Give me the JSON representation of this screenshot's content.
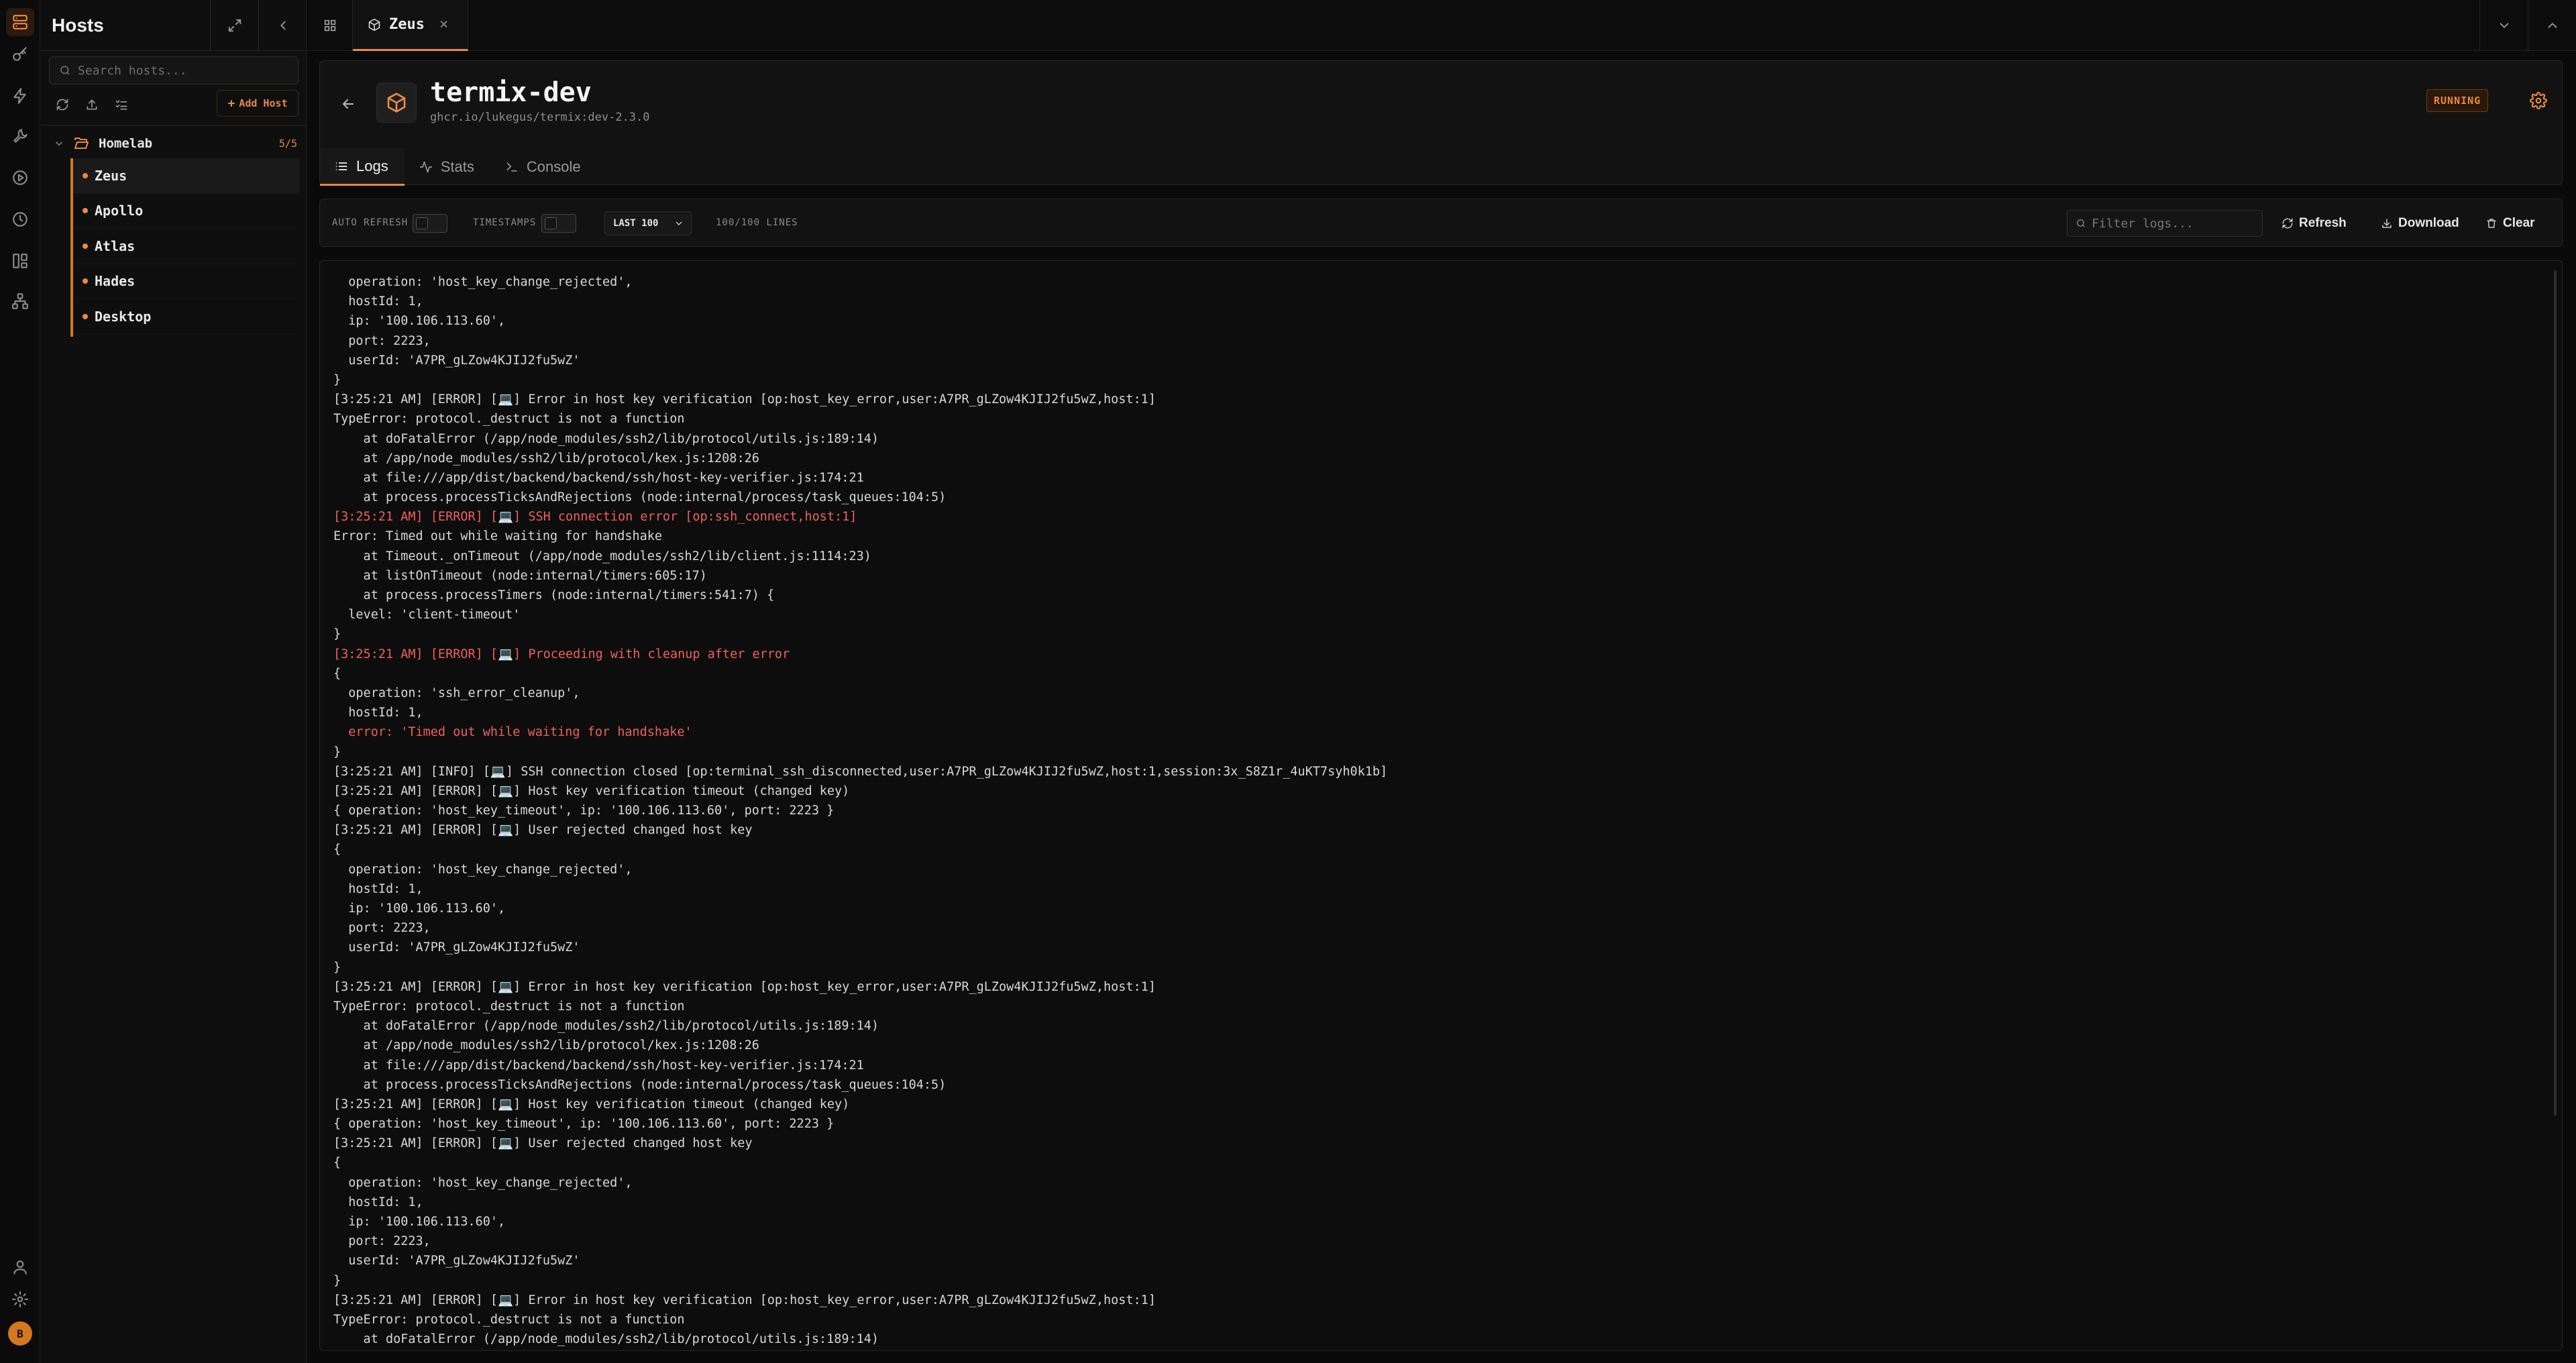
{
  "sidebar": {
    "title": "Hosts",
    "search_placeholder": "Search hosts...",
    "add_host_label": "Add Host",
    "folder": {
      "name": "Homelab",
      "count": "5/5"
    },
    "hosts": [
      "Zeus",
      "Apollo",
      "Atlas",
      "Hades",
      "Desktop"
    ],
    "user_initial": "B"
  },
  "tabbar": {
    "active_tab": "Zeus"
  },
  "container": {
    "name": "termix-dev",
    "image": "ghcr.io/lukegus/termix:dev-2.3.0",
    "status": "RUNNING",
    "tabs": [
      "Logs",
      "Stats",
      "Console"
    ]
  },
  "toolbar": {
    "auto_refresh_label": "AUTO REFRESH",
    "auto_refresh_on": false,
    "timestamps_label": "TIMESTAMPS",
    "timestamps_on": false,
    "range_selected": "LAST 100",
    "lines_count": "100/100 LINES",
    "filter_placeholder": "Filter logs...",
    "refresh_label": "Refresh",
    "download_label": "Download",
    "clear_label": "Clear"
  },
  "colors": {
    "accent": "#e98a42",
    "error": "#f0605f",
    "background": "#0a0a0a"
  },
  "logs": [
    {
      "t": "  operation: 'host_key_change_rejected',",
      "c": "n"
    },
    {
      "t": "  hostId: 1,",
      "c": "n"
    },
    {
      "t": "  ip: '100.106.113.60',",
      "c": "n"
    },
    {
      "t": "  port: 2223,",
      "c": "n"
    },
    {
      "t": "  userId: 'A7PR_gLZow4KJIJ2fu5wZ'",
      "c": "n"
    },
    {
      "t": "}",
      "c": "n"
    },
    {
      "t": "[3:25:21 AM] [ERROR] [💻] Error in host key verification [op:host_key_error,user:A7PR_gLZow4KJIJ2fu5wZ,host:1]",
      "c": "n"
    },
    {
      "t": "TypeError: protocol._destruct is not a function",
      "c": "n"
    },
    {
      "t": "    at doFatalError (/app/node_modules/ssh2/lib/protocol/utils.js:189:14)",
      "c": "n"
    },
    {
      "t": "    at /app/node_modules/ssh2/lib/protocol/kex.js:1208:26",
      "c": "n"
    },
    {
      "t": "    at file:///app/dist/backend/backend/ssh/host-key-verifier.js:174:21",
      "c": "n"
    },
    {
      "t": "    at process.processTicksAndRejections (node:internal/process/task_queues:104:5)",
      "c": "n"
    },
    {
      "t": "[3:25:21 AM] [ERROR] [💻] SSH connection error [op:ssh_connect,host:1]",
      "c": "e"
    },
    {
      "t": "Error: Timed out while waiting for handshake",
      "c": "n"
    },
    {
      "t": "    at Timeout._onTimeout (/app/node_modules/ssh2/lib/client.js:1114:23)",
      "c": "n"
    },
    {
      "t": "    at listOnTimeout (node:internal/timers:605:17)",
      "c": "n"
    },
    {
      "t": "    at process.processTimers (node:internal/timers:541:7) {",
      "c": "n"
    },
    {
      "t": "  level: 'client-timeout'",
      "c": "n"
    },
    {
      "t": "}",
      "c": "n"
    },
    {
      "t": "[3:25:21 AM] [ERROR] [💻] Proceeding with cleanup after error",
      "c": "e"
    },
    {
      "t": "{",
      "c": "n"
    },
    {
      "t": "  operation: 'ssh_error_cleanup',",
      "c": "n"
    },
    {
      "t": "  hostId: 1,",
      "c": "n"
    },
    {
      "t": "  error: 'Timed out while waiting for handshake'",
      "c": "e"
    },
    {
      "t": "}",
      "c": "n"
    },
    {
      "t": "[3:25:21 AM] [INFO] [💻] SSH connection closed [op:terminal_ssh_disconnected,user:A7PR_gLZow4KJIJ2fu5wZ,host:1,session:3x_S8Z1r_4uKT7syh0k1b]",
      "c": "n"
    },
    {
      "t": "[3:25:21 AM] [ERROR] [💻] Host key verification timeout (changed key)",
      "c": "n"
    },
    {
      "t": "{ operation: 'host_key_timeout', ip: '100.106.113.60', port: 2223 }",
      "c": "n"
    },
    {
      "t": "[3:25:21 AM] [ERROR] [💻] User rejected changed host key",
      "c": "n"
    },
    {
      "t": "{",
      "c": "n"
    },
    {
      "t": "  operation: 'host_key_change_rejected',",
      "c": "n"
    },
    {
      "t": "  hostId: 1,",
      "c": "n"
    },
    {
      "t": "  ip: '100.106.113.60',",
      "c": "n"
    },
    {
      "t": "  port: 2223,",
      "c": "n"
    },
    {
      "t": "  userId: 'A7PR_gLZow4KJIJ2fu5wZ'",
      "c": "n"
    },
    {
      "t": "}",
      "c": "n"
    },
    {
      "t": "[3:25:21 AM] [ERROR] [💻] Error in host key verification [op:host_key_error,user:A7PR_gLZow4KJIJ2fu5wZ,host:1]",
      "c": "n"
    },
    {
      "t": "TypeError: protocol._destruct is not a function",
      "c": "n"
    },
    {
      "t": "    at doFatalError (/app/node_modules/ssh2/lib/protocol/utils.js:189:14)",
      "c": "n"
    },
    {
      "t": "    at /app/node_modules/ssh2/lib/protocol/kex.js:1208:26",
      "c": "n"
    },
    {
      "t": "    at file:///app/dist/backend/backend/ssh/host-key-verifier.js:174:21",
      "c": "n"
    },
    {
      "t": "    at process.processTicksAndRejections (node:internal/process/task_queues:104:5)",
      "c": "n"
    },
    {
      "t": "[3:25:21 AM] [ERROR] [💻] Host key verification timeout (changed key)",
      "c": "n"
    },
    {
      "t": "{ operation: 'host_key_timeout', ip: '100.106.113.60', port: 2223 }",
      "c": "n"
    },
    {
      "t": "[3:25:21 AM] [ERROR] [💻] User rejected changed host key",
      "c": "n"
    },
    {
      "t": "{",
      "c": "n"
    },
    {
      "t": "  operation: 'host_key_change_rejected',",
      "c": "n"
    },
    {
      "t": "  hostId: 1,",
      "c": "n"
    },
    {
      "t": "  ip: '100.106.113.60',",
      "c": "n"
    },
    {
      "t": "  port: 2223,",
      "c": "n"
    },
    {
      "t": "  userId: 'A7PR_gLZow4KJIJ2fu5wZ'",
      "c": "n"
    },
    {
      "t": "}",
      "c": "n"
    },
    {
      "t": "[3:25:21 AM] [ERROR] [💻] Error in host key verification [op:host_key_error,user:A7PR_gLZow4KJIJ2fu5wZ,host:1]",
      "c": "n"
    },
    {
      "t": "TypeError: protocol._destruct is not a function",
      "c": "n"
    },
    {
      "t": "    at doFatalError (/app/node_modules/ssh2/lib/protocol/utils.js:189:14)",
      "c": "n"
    }
  ]
}
